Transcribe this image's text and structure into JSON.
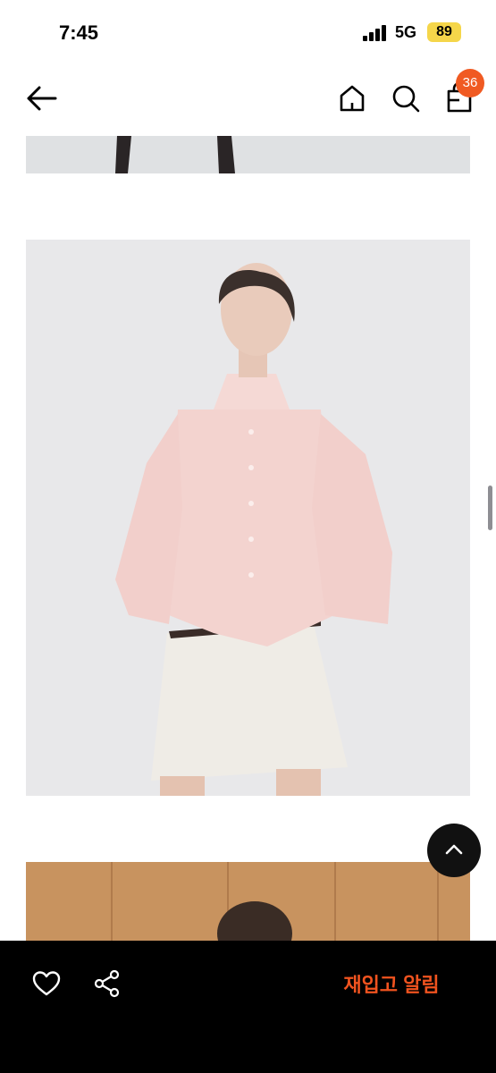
{
  "status_bar": {
    "time": "7:45",
    "network": "5G",
    "battery": "89"
  },
  "nav": {
    "back_icon": "arrow-left-icon",
    "home_icon": "home-icon",
    "search_icon": "search-icon",
    "bag_icon": "shopping-bag-icon",
    "cart_count": "36"
  },
  "images": [
    {
      "name": "product-photo-legs-crop"
    },
    {
      "name": "product-photo-pink-cardigan"
    },
    {
      "name": "product-photo-wood-backdrop"
    }
  ],
  "scroll_top_icon": "chevron-up-icon",
  "bottom_bar": {
    "like_icon": "heart-outline-icon",
    "share_icon": "share-icon",
    "restock_label": "재입고 알림"
  },
  "colors": {
    "accent": "#f05a22",
    "restock_text": "#f0531f",
    "bottom_bar_bg": "#000000"
  }
}
